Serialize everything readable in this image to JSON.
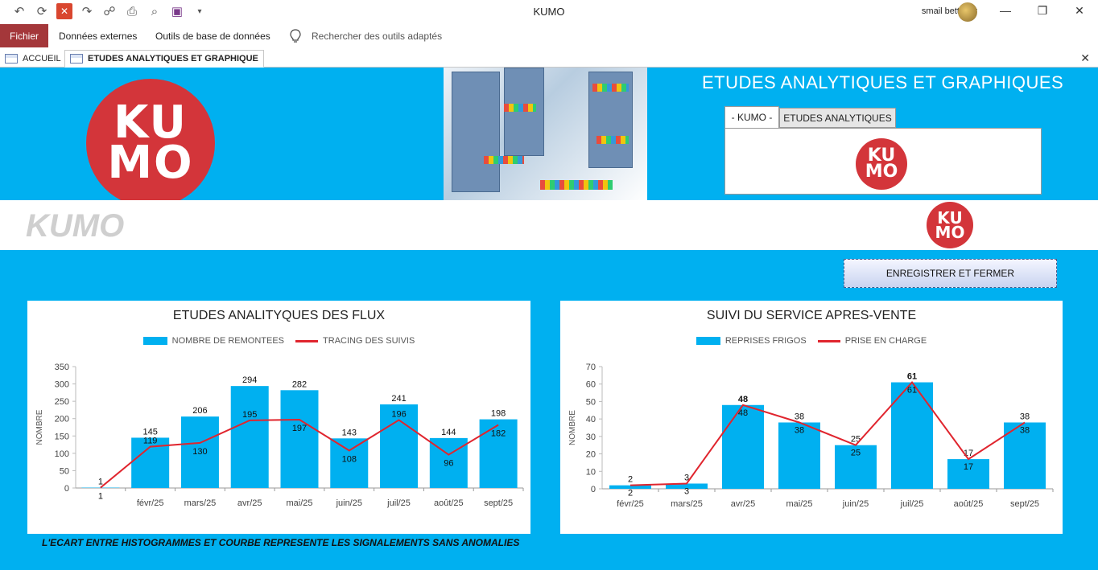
{
  "window": {
    "title": "KUMO",
    "user_name": "smail bettahar",
    "quick_access_icons": [
      "undo-icon",
      "refresh-icon",
      "close-red-icon",
      "redo-icon",
      "attach-icon",
      "sync-icon",
      "print-preview-icon",
      "save-icon",
      "customize-icon"
    ]
  },
  "ribbon": {
    "file_label": "Fichier",
    "items": [
      "Données externes",
      "Outils de base de données"
    ],
    "search_placeholder": "Rechercher des outils adaptés"
  },
  "doc_tabs": [
    {
      "label": "ACCUEIL",
      "active": false
    },
    {
      "label": "ETUDES ANALYTIQUES ET GRAPHIQUE",
      "active": true
    }
  ],
  "form": {
    "title": "ETUDES ANALYTIQUES ET GRAPHIQUES",
    "logo_lines": [
      "KU",
      "MO"
    ],
    "tabs": [
      "- KUMO -",
      "ETUDES ANALYTIQUES"
    ],
    "band_text": "KUMO",
    "save_button": "ENREGISTRER ET FERMER",
    "footnote": "L'ECART ENTRE HISTOGRAMMES ET COURBE REPRESENTE LES  SIGNALEMENTS SANS ANOMALIES",
    "colors": {
      "form_bg": "#00b0f0",
      "logo_red": "#d3353a",
      "bar": "#00b0f0",
      "line": "#e0252e",
      "file_tab": "#a4373a"
    }
  },
  "chart_data": [
    {
      "type": "bar",
      "title": "ETUDES ANALITYQUES DES FLUX",
      "ylabel": "NOMBRE",
      "xlabel": "",
      "ylim": [
        0,
        350
      ],
      "yticks": [
        0,
        50,
        100,
        150,
        200,
        250,
        300,
        350
      ],
      "categories": [
        "",
        "févr/25",
        "mars/25",
        "avr/25",
        "mai/25",
        "juin/25",
        "juil/25",
        "août/25",
        "sept/25"
      ],
      "legend": "top",
      "grid": false,
      "series": [
        {
          "name": "NOMBRE DE REMONTEES",
          "kind": "bar",
          "values": [
            1,
            145,
            206,
            294,
            282,
            143,
            241,
            144,
            198
          ]
        },
        {
          "name": "TRACING DES SUIVIS",
          "kind": "line",
          "values": [
            1,
            119,
            130,
            195,
            197,
            108,
            196,
            96,
            182
          ]
        }
      ]
    },
    {
      "type": "bar",
      "title": "SUIVI DU SERVICE APRES-VENTE",
      "ylabel": "NOMBRE",
      "xlabel": "",
      "ylim": [
        0,
        70
      ],
      "yticks": [
        0,
        10,
        20,
        30,
        40,
        50,
        60,
        70
      ],
      "categories": [
        "févr/25",
        "mars/25",
        "avr/25",
        "mai/25",
        "juin/25",
        "juil/25",
        "août/25",
        "sept/25"
      ],
      "legend": "top",
      "grid": false,
      "series": [
        {
          "name": "REPRISES FRIGOS",
          "kind": "bar",
          "values": [
            2,
            3,
            48,
            38,
            25,
            61,
            17,
            38
          ],
          "labels": [
            "2",
            "3",
            "48",
            "38",
            "25",
            "61",
            "17",
            "38"
          ]
        },
        {
          "name": "PRISE EN CHARGE",
          "kind": "line",
          "values": [
            2,
            3,
            48,
            38,
            25,
            61,
            17,
            38
          ],
          "labels": [
            "2",
            "3",
            "48",
            "38",
            "25",
            "61",
            "17",
            "38"
          ]
        }
      ]
    }
  ]
}
